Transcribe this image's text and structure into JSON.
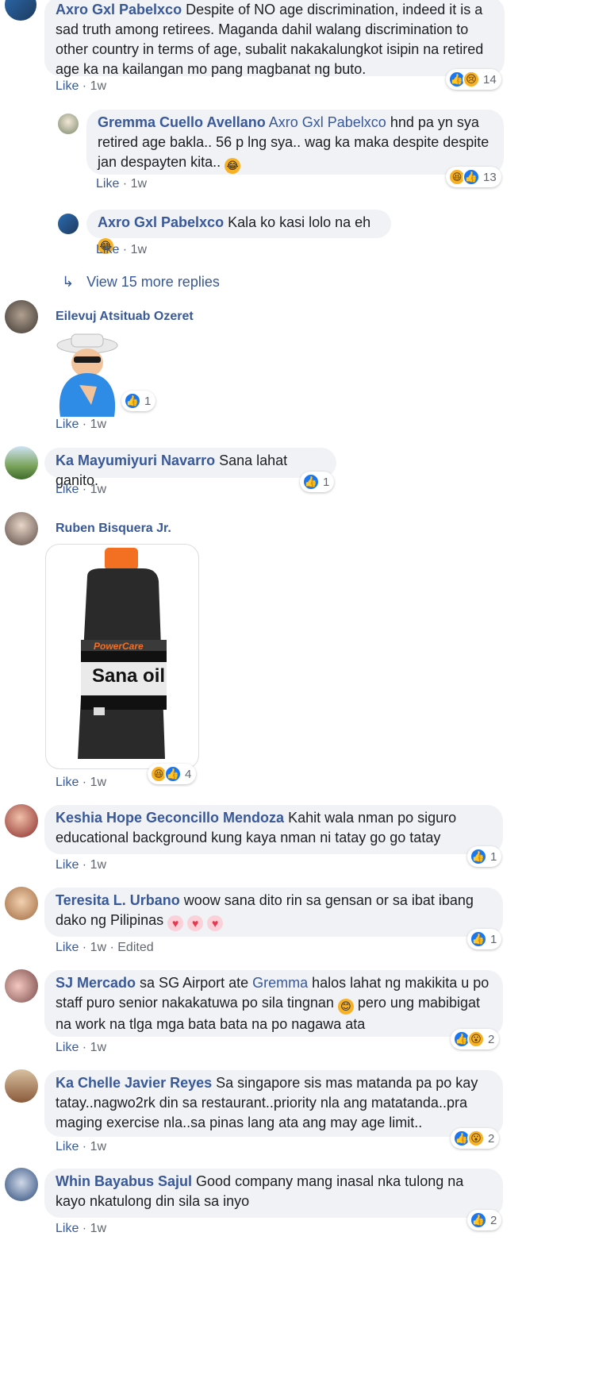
{
  "meta": {
    "like": "Like",
    "sep": " · ",
    "time": "1w",
    "edited": " · Edited"
  },
  "c1": {
    "name": "Axro Gxl Pabelxco",
    "text": " Despite of NO age discrimination, indeed it is a sad truth among retirees. Maganda dahil walang discrimination to other country in terms of age, subalit nakakalungkot isipin na retired age ka na kailangan mo pang magbanat ng buto.",
    "reactions": "14"
  },
  "r1": {
    "name": "Gremma Cuello Avellano",
    "mention": "Axro Gxl Pabelxco",
    "text": " hnd pa yn sya retired age bakla.. 56 p lng sya.. wag ka maka despite despite jan despayten kita.. ",
    "reactions": "13"
  },
  "r2": {
    "name": "Axro Gxl Pabelxco",
    "text": " Kala ko kasi lolo na eh"
  },
  "more_replies": "View 15 more replies",
  "c2": {
    "name": "Eilevuj Atsituab Ozeret",
    "reactions": "1"
  },
  "c3": {
    "name": "Ka Mayumiyuri Navarro",
    "text": " Sana lahat ganito.",
    "reactions": "1"
  },
  "c4": {
    "name": "Ruben Bisquera Jr.",
    "brand": "PowerCare",
    "label": "Sana oil",
    "reactions": "4"
  },
  "c5": {
    "name": "Keshia Hope Geconcillo Mendoza",
    "text": " Kahit wala nman po siguro educational background kung kaya nman ni tatay go go tatay",
    "reactions": "1"
  },
  "c6": {
    "name": "Teresita L. Urbano",
    "text": " woow sana dito rin sa gensan or sa ibat ibang dako ng Pilipinas ",
    "reactions": "1"
  },
  "c7": {
    "name": "SJ Mercado",
    "pre": " sa SG Airport ate ",
    "mention": "Gremma",
    "text": " halos lahat ng makikita u po staff puro senior nakakatuwa po sila tingnan ",
    "text2": " pero ung mabibigat na work na tlga mga bata bata na po nagawa ata",
    "reactions": "2"
  },
  "c8": {
    "name": "Ka Chelle Javier Reyes",
    "text": " Sa singapore sis mas matanda pa po kay tatay..nagwo2rk din sa restaurant..priority nla ang matatanda..pra maging exercise nla..sa pinas lang ata ang may age limit..",
    "reactions": "2"
  },
  "c9": {
    "name": "Whin Bayabus Sajul",
    "text": " Good company mang inasal nka tulong na kayo nkatulong din sila sa inyo",
    "reactions": "2"
  },
  "colors": {
    "link": "#385898",
    "bubble": "#f0f2f5",
    "like_blue": "#1877f2"
  }
}
